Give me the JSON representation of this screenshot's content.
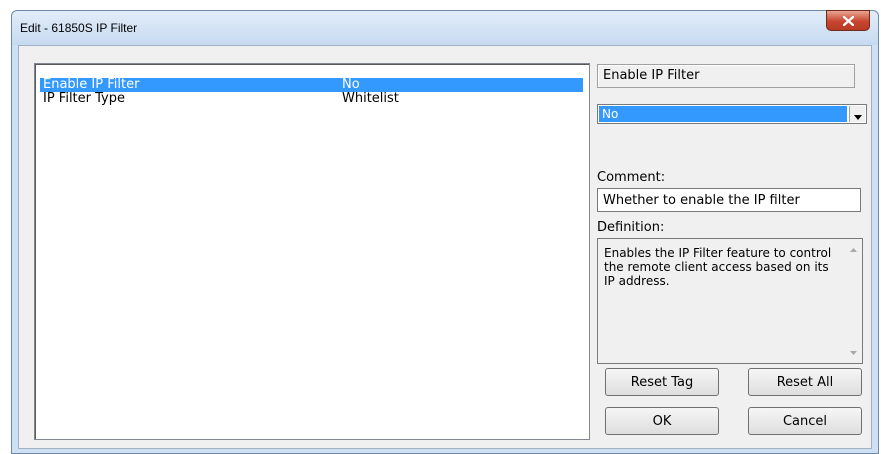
{
  "window": {
    "title": "Edit - 61850S IP Filter"
  },
  "list": {
    "rows": [
      {
        "name": "Enable IP Filter",
        "value": "No",
        "selected": true
      },
      {
        "name": "IP Filter Type",
        "value": "Whitelist",
        "selected": false
      }
    ]
  },
  "editor": {
    "field_name": "Enable IP Filter",
    "selected_value": "No",
    "comment_label": "Comment:",
    "comment_value": "Whether to enable the IP filter",
    "definition_label": "Definition:",
    "definition_text": "Enables the IP Filter feature to control the remote client access based on its IP address."
  },
  "buttons": {
    "reset_tag": "Reset Tag",
    "reset_all": "Reset All",
    "ok": "OK",
    "cancel": "Cancel"
  },
  "colors": {
    "selection": "#3399ff",
    "close_button": "#c7452e",
    "frame": "#cfe0f3"
  },
  "icons": {
    "close": "close-icon",
    "dropdown": "chevron-down-icon",
    "scroll_up": "scroll-up-arrow-icon",
    "scroll_down": "scroll-down-arrow-icon"
  }
}
